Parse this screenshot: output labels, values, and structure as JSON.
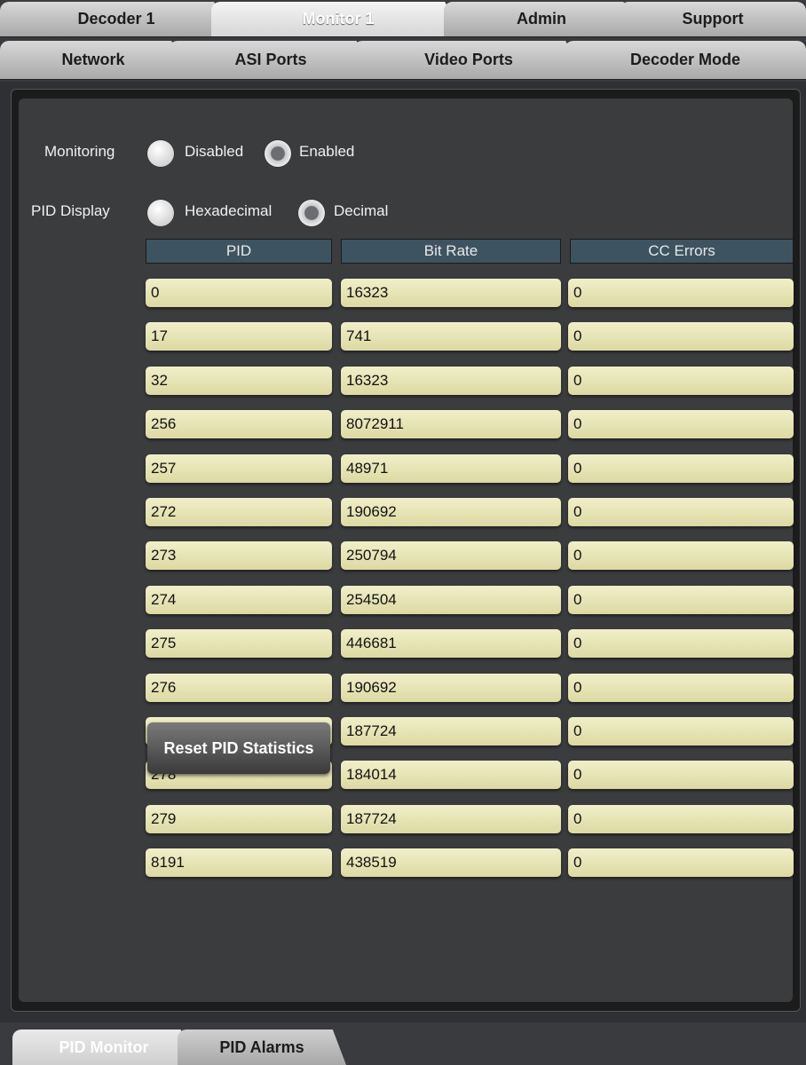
{
  "top_tabs": [
    {
      "label": "Decoder 1",
      "active": false
    },
    {
      "label": "Monitor 1",
      "active": true
    },
    {
      "label": "Admin",
      "active": false
    },
    {
      "label": "Support",
      "active": false
    }
  ],
  "sub_tabs": [
    {
      "label": "Network"
    },
    {
      "label": "ASI Ports"
    },
    {
      "label": "Video Ports"
    },
    {
      "label": "Decoder Mode"
    }
  ],
  "monitoring": {
    "label": "Monitoring",
    "options": [
      "Disabled",
      "Enabled"
    ],
    "selected": "Enabled"
  },
  "pid_display": {
    "label": "PID Display",
    "options": [
      "Hexadecimal",
      "Decimal"
    ],
    "selected": "Decimal"
  },
  "table": {
    "headers": [
      "PID",
      "Bit Rate",
      "CC Errors"
    ],
    "rows": [
      [
        "0",
        "16323",
        "0"
      ],
      [
        "17",
        "741",
        "0"
      ],
      [
        "32",
        "16323",
        "0"
      ],
      [
        "256",
        "8072911",
        "0"
      ],
      [
        "257",
        "48971",
        "0"
      ],
      [
        "272",
        "190692",
        "0"
      ],
      [
        "273",
        "250794",
        "0"
      ],
      [
        "274",
        "254504",
        "0"
      ],
      [
        "275",
        "446681",
        "0"
      ],
      [
        "276",
        "190692",
        "0"
      ],
      [
        "277",
        "187724",
        "0"
      ],
      [
        "278",
        "184014",
        "0"
      ],
      [
        "279",
        "187724",
        "0"
      ],
      [
        "8191",
        "438519",
        "0"
      ]
    ]
  },
  "reset_button": "Reset PID Statistics",
  "bottom_tabs": [
    {
      "label": "PID Monitor",
      "active": true
    },
    {
      "label": "PID Alarms",
      "active": false
    }
  ]
}
